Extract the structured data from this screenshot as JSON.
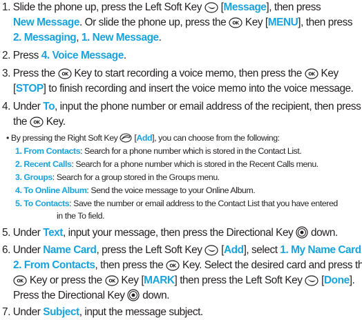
{
  "lines": [
    {
      "n": "1. Slide the phone up, press the Left Soft Key ",
      "a": " [",
      "b": "Message",
      "c": "], then press"
    },
    {
      "a": "New Message",
      "b": ". Or slide the phone up, press the ",
      "c": " Key [",
      "d": "MENU",
      "e": "], then press"
    },
    {
      "a": "2. Messaging",
      "b": ", ",
      "c": "1. New Message",
      "d": "."
    },
    {
      "a": "2. Press ",
      "b": "4. Voice Message",
      "c": "."
    },
    {
      "a": "3. Press the ",
      "b": " Key to start recording a voice memo, then press the ",
      "c": " Key"
    },
    {
      "a": "[",
      "b": "STOP",
      "c": "] to finish recording and insert the voice memo into the voice message."
    },
    {
      "a": "4. Under ",
      "b": "To",
      "c": ", input the phone number or email address of the recipient, then press"
    },
    {
      "a": "the ",
      "b": " Key."
    },
    {
      "a": "• By pressing the Right Soft Key ",
      "b": " [",
      "c": "Add",
      "d": "], you can choose from the following:"
    },
    {
      "a": "1. From Contacts",
      "b": ": Search for a phone number which is stored in the Contact List."
    },
    {
      "a": "2. Recent Calls",
      "b": ": Search for a phone number which is stored in the Recent Calls menu."
    },
    {
      "a": "3. Groups",
      "b": ": Search for a group stored in the Groups menu."
    },
    {
      "a": "4. To Online Album",
      "b": ": Send the voice message to your Online Album."
    },
    {
      "a": "5. To Contacts",
      "b": ": Save the number or email address to the Contact List that you have entered"
    },
    {
      "a": "in the To field."
    },
    {
      "a": "5. Under ",
      "b": "Text",
      "c": ", input your message, then press the Directional Key ",
      "d": " down."
    },
    {
      "a": "6. Under ",
      "b": "Name Card",
      "c": ", press the Left Soft Key ",
      "d": " [",
      "e": "Add",
      "f": "], select ",
      "g": "1. My Name Card",
      "h": ","
    },
    {
      "a": "2. From Contacts",
      "b": ", then press the ",
      "c": " Key. Select the desired card and press the"
    },
    {
      "a": " Key or press the ",
      "b": " Key [",
      "c": "MARK",
      "d": "] then press the Left Soft Key ",
      "e": " [",
      "f": "Done",
      "g": "]."
    },
    {
      "a": "Press the Directional Key ",
      "b": " down."
    },
    {
      "a": "7. Under ",
      "b": "Subject",
      "c": ", input the message subject."
    }
  ],
  "icons": {
    "ok": "ok-key-icon",
    "left_soft": "left-soft-key-icon",
    "right_soft": "right-soft-key-icon",
    "directional": "directional-key-icon"
  },
  "colors": {
    "highlight": "#1aa3dc",
    "text": "#231f20"
  }
}
